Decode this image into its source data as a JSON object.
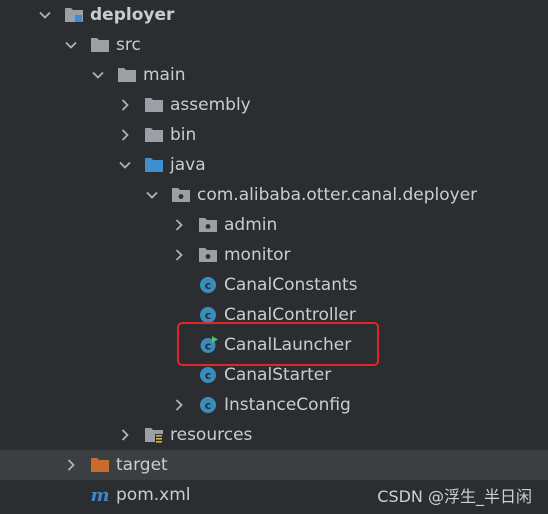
{
  "tree": {
    "root": {
      "label": "deployer",
      "icon": "module-folder-icon"
    },
    "src": {
      "label": "src",
      "icon": "folder-icon"
    },
    "main": {
      "label": "main",
      "icon": "folder-icon"
    },
    "assembly": {
      "label": "assembly",
      "icon": "folder-icon"
    },
    "bin": {
      "label": "bin",
      "icon": "folder-icon"
    },
    "java": {
      "label": "java",
      "icon": "source-root-folder-icon"
    },
    "package": {
      "label": "com.alibaba.otter.canal.deployer",
      "icon": "package-icon"
    },
    "admin": {
      "label": "admin",
      "icon": "package-icon"
    },
    "monitor": {
      "label": "monitor",
      "icon": "package-icon"
    },
    "canal_constants": {
      "label": "CanalConstants",
      "icon": "class-icon"
    },
    "canal_controller": {
      "label": "CanalController",
      "icon": "class-icon"
    },
    "canal_launcher": {
      "label": "CanalLauncher",
      "icon": "runnable-class-icon"
    },
    "canal_starter": {
      "label": "CanalStarter",
      "icon": "class-icon"
    },
    "instance_config": {
      "label": "InstanceConfig",
      "icon": "class-icon"
    },
    "resources": {
      "label": "resources",
      "icon": "resources-folder-icon"
    },
    "target": {
      "label": "target",
      "icon": "excluded-folder-icon"
    },
    "pom": {
      "label": "pom.xml",
      "icon": "maven-icon"
    }
  },
  "watermark": "CSDN @浮生_半日闲",
  "colors": {
    "background": "#2b2d30",
    "text": "#c9cdd3",
    "selected_row": "#3c3f41",
    "highlight": "#e0262a",
    "class_icon": "#3a8dba",
    "target_folder": "#c96a2e",
    "maven": "#3d86c7"
  }
}
